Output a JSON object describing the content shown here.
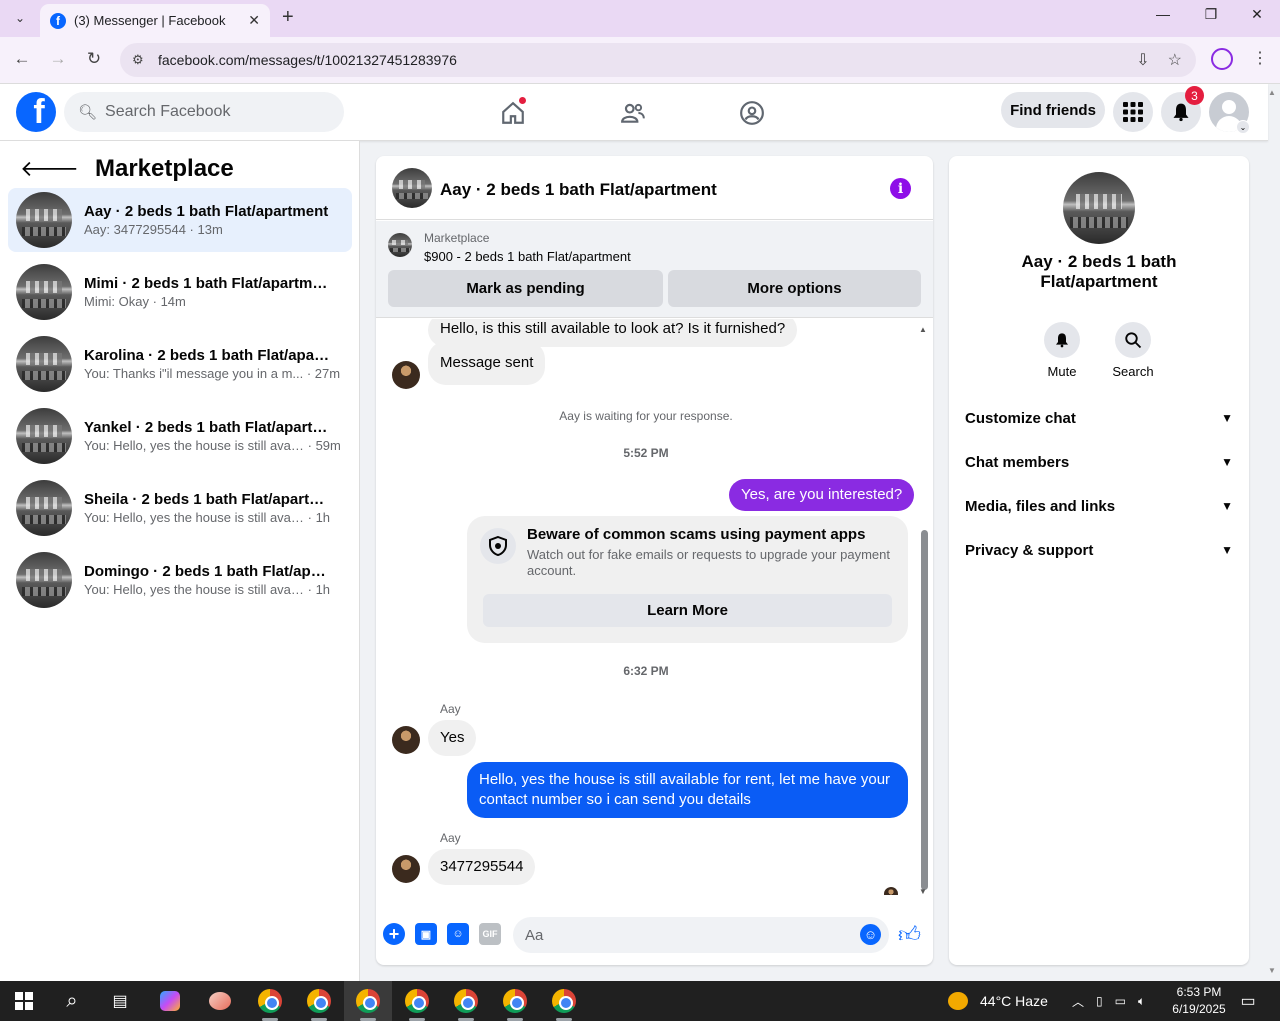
{
  "browser": {
    "tab_title": "(3) Messenger | Facebook",
    "url": "facebook.com/messages/t/10021327451283976"
  },
  "fb_header": {
    "search_placeholder": "Search Facebook",
    "find_friends": "Find friends",
    "notifications_count": "3"
  },
  "left": {
    "title": "Marketplace",
    "conversations": [
      {
        "name": "Aay · 2 beds 1 bath Flat/apartment",
        "preview": "Aay: 3477295544",
        "time": "13m",
        "active": true
      },
      {
        "name": "Mimi · 2 beds 1 bath Flat/apartment",
        "preview": "Mimi: Okay",
        "time": "14m"
      },
      {
        "name": "Karolina · 2 beds 1 bath Flat/apart...",
        "preview": "You: Thanks i\"il message you in a m...",
        "time": "27m"
      },
      {
        "name": "Yankel · 2 beds 1 bath Flat/apartm...",
        "preview": "You: Hello, yes the house is still avail...",
        "time": "59m"
      },
      {
        "name": "Sheila · 2 beds 1 bath Flat/apartme...",
        "preview": "You: Hello, yes the house is still availa...",
        "time": "1h"
      },
      {
        "name": "Domingo · 2 beds 1 bath Flat/apar...",
        "preview": "You: Hello, yes the house is still availa...",
        "time": "1h"
      }
    ]
  },
  "chat": {
    "title": "Aay · 2 beds 1 bath Flat/apartment",
    "marketplace_label": "Marketplace",
    "listing": "$900 - 2 beds 1 bath Flat/apartment",
    "mark_pending": "Mark as pending",
    "more_options": "More options",
    "msg_1": "Hello, is this still available to look at? Is it furnished?",
    "msg_2": "Message sent",
    "waiting": "Aay is waiting for your response.",
    "time_1": "5:52 PM",
    "msg_3": "Yes, are you interested?",
    "scam_title": "Beware of common scams using payment apps",
    "scam_text": "Watch out for fake emails or requests to upgrade your payment account.",
    "learn_more": "Learn More",
    "time_2": "6:32 PM",
    "sender_1": "Aay",
    "msg_4": "Yes",
    "msg_5": "Hello, yes the house is still available for rent, let me have your contact number so i can send you details",
    "sender_2": "Aay",
    "msg_6": "3477295544",
    "composer_placeholder": "Aa"
  },
  "right": {
    "name": "Aay · 2 beds 1 bath Flat/apartment",
    "mute": "Mute",
    "search": "Search",
    "sections": [
      "Customize chat",
      "Chat members",
      "Media, files and links",
      "Privacy & support"
    ]
  },
  "taskbar": {
    "weather": "44°C  Haze",
    "time": "6:53 PM",
    "date": "6/19/2025"
  },
  "colors": {
    "fb_blue": "#0866ff",
    "purple_bubble": "#8a2be2",
    "blue_bubble": "#0a5cf5"
  }
}
